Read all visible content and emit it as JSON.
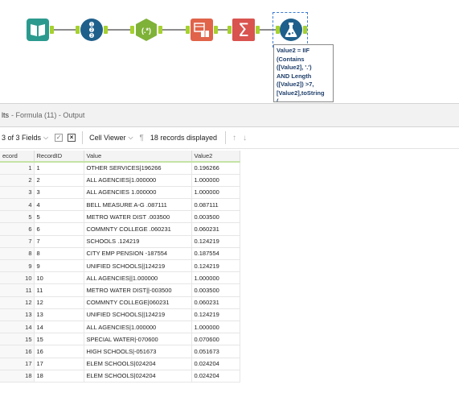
{
  "canvas": {
    "tools": [
      {
        "name": "input-data-tool",
        "icon": "book-icon",
        "color": "#2b9a8e"
      },
      {
        "name": "record-id-tool",
        "icon": "numbered-list-icon",
        "color": "#1f5f8b"
      },
      {
        "name": "regex-tool",
        "icon": "regex-icon",
        "color": "#7fb238"
      },
      {
        "name": "text-to-columns-tool",
        "icon": "table-icon",
        "color": "#e0634a"
      },
      {
        "name": "summarize-tool",
        "icon": "sigma-icon",
        "color": "#d9534f"
      },
      {
        "name": "formula-tool",
        "icon": "flask-icon",
        "color": "#1f5f8b"
      }
    ],
    "annotation": "Value2 = IIF\n(Contains\n([Value2], '.')\nAND Length\n([Value2]) >7,\n[Value2],toString\n("
  },
  "results": {
    "title": "lts",
    "subtitle": "- Formula (11) - Output",
    "toolbar": {
      "fields_label": "3 of 3 Fields",
      "cell_viewer_label": "Cell Viewer",
      "records_label": "18 records displayed"
    },
    "columns": [
      "ecord",
      "RecordID",
      "Value",
      "Value2"
    ],
    "rows": [
      [
        "1",
        "1",
        "OTHER SERVICES|196266",
        "0.196266"
      ],
      [
        "2",
        "2",
        "ALL AGENCIES|1.000000",
        "1.000000"
      ],
      [
        "3",
        "3",
        "ALL AGENCIES 1.000000",
        "1.000000"
      ],
      [
        "4",
        "4",
        "BELL MEASURE A-G .087111",
        "0.087111"
      ],
      [
        "5",
        "5",
        "METRO WATER DIST .003500",
        "0.003500"
      ],
      [
        "6",
        "6",
        "COMMNTY COLLEGE .060231",
        "0.060231"
      ],
      [
        "7",
        "7",
        "SCHOOLS .124219",
        "0.124219"
      ],
      [
        "8",
        "8",
        "CITY EMP PENSION -187554",
        "0.187554"
      ],
      [
        "9",
        "9",
        "UNIFIED SCHOOLS||124219",
        "0.124219"
      ],
      [
        "10",
        "10",
        "ALL AGENCIES||1.000000",
        "1.000000"
      ],
      [
        "11",
        "11",
        "METRO WATER DIST||-003500",
        "0.003500"
      ],
      [
        "12",
        "12",
        "COMMNTY COLLEGE|060231",
        "0.060231"
      ],
      [
        "13",
        "13",
        "UNIFIED SCHOOLS||124219",
        "0.124219"
      ],
      [
        "14",
        "14",
        "ALL AGENCIES|1.000000",
        "1.000000"
      ],
      [
        "15",
        "15",
        "SPECIAL WATER|-070600",
        "0.070600"
      ],
      [
        "16",
        "16",
        "HIGH SCHOOLS|-051673",
        "0.051673"
      ],
      [
        "17",
        "17",
        "ELEM SCHOOLS|024204",
        "0.024204"
      ],
      [
        "18",
        "18",
        "ELEM SCHOOLS|024204",
        "0.024204"
      ]
    ]
  }
}
